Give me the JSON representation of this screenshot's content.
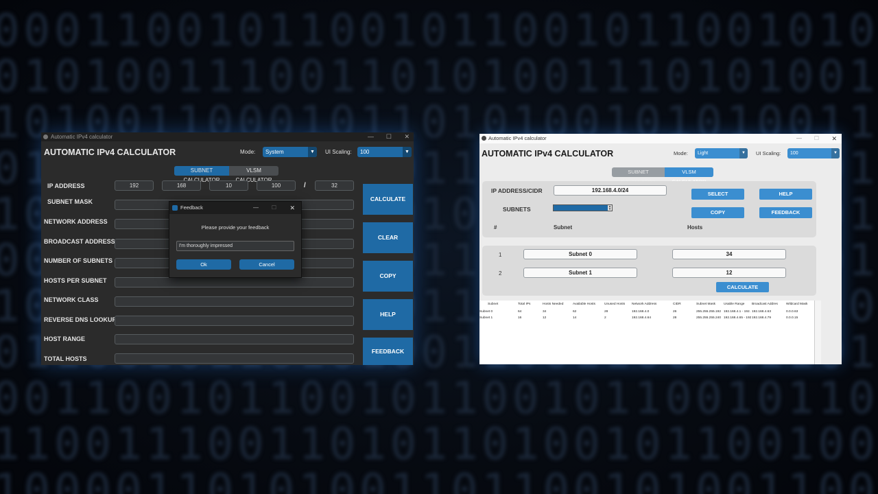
{
  "background": {
    "rows": [
      "000110010110010110010110010100010101110",
      "010100111001101010011101010011011001101",
      "101001100010110101001010100110101101010",
      "011010001011001100101011001010110010110",
      "100110101001101010110011010010110011010",
      "001101001011001101010011001011010010110",
      "101011010011001101010011010100110101100",
      "011001011010100110011001011010011001110",
      "001100101100101100101100101100101100101",
      "110011100110101101001011001001011100111",
      "100001101010011011001010011001010111010"
    ]
  },
  "dark_app": {
    "window_title": "Automatic IPv4 calculator",
    "app_title": "AUTOMATIC IPv4 CALCULATOR",
    "mode_label": "Mode:",
    "mode_value": "System",
    "scaling_label": "UI Scaling:",
    "scaling_value": "100",
    "tabs": [
      "SUBNET CALCULATOR",
      "VLSM CALCULATOR"
    ],
    "active_tab": "SUBNET CALCULATOR",
    "ip_label": "IP  ADDRESS",
    "octets": [
      "192",
      "168",
      "10",
      "100"
    ],
    "slash": "/",
    "cidr": "32",
    "labels": {
      "subnet_mask": "SUBNET  MASK",
      "network_address": "NETWORK ADDRESS",
      "broadcast_address": "BROADCAST ADDRESS",
      "number_of_subnets": "NUMBER OF SUBNETS",
      "hosts_per_subnet": "HOSTS PER SUBNET",
      "network_class": "NETWORK CLASS",
      "reverse_dns": "REVERSE DNS LOOKUP",
      "host_range": "HOST RANGE",
      "total_hosts": "TOTAL HOSTS"
    },
    "buttons": [
      "CALCULATE",
      "CLEAR",
      "COPY",
      "HELP",
      "FEEDBACK"
    ],
    "accent": "#1f6aa5"
  },
  "feedback_dialog": {
    "title": "Feedback",
    "prompt": "Please provide your feedback",
    "input_value": "I'm thoroughly impressed",
    "ok_label": "Ok",
    "cancel_label": "Cancel"
  },
  "light_app": {
    "window_title": "Automatic IPv4 calculator",
    "app_title": "AUTOMATIC IPv4 CALCULATOR",
    "mode_label": "Mode:",
    "mode_value": "Light",
    "scaling_label": "UI Scaling:",
    "scaling_value": "100",
    "tabs": [
      "SUBNET CALCULATOR",
      "VLSM CALCULATOR"
    ],
    "active_tab": "VLSM CALCULATOR",
    "ip_cidr_label": "IP ADDRESS/CIDR",
    "ip_cidr_value": "192.168.4.0/24",
    "subnets_label": "SUBNETS",
    "subnets_value": "2",
    "buttons": {
      "select": "SELECT",
      "help": "HELP",
      "copy": "COPY",
      "feedback": "FEEDBACK",
      "calculate": "CALCULATE"
    },
    "col_headers": {
      "num": "#",
      "subnet": "Subnet",
      "hosts": "Hosts"
    },
    "subnet_rows": [
      {
        "num": "1",
        "name": "Subnet 0",
        "hosts": "34"
      },
      {
        "num": "2",
        "name": "Subnet 1",
        "hosts": "12"
      }
    ],
    "results": {
      "headers": [
        "Subnet",
        "Total IPs",
        "Hosts Needed",
        "Available Hosts",
        "Unused Hosts",
        "Network Address",
        "CIDR",
        "Subnet Mask",
        "Usable Range",
        "Broadcast Addres",
        "Wildcard Mask"
      ],
      "rows": [
        [
          "Subnet 0",
          "64",
          "34",
          "62",
          "28",
          "192.168.4.0",
          "26",
          "255.255.255.192",
          "192.168.4.1 - 192.",
          "192.168.4.63",
          "0.0.0.63"
        ],
        [
          "Subnet 1",
          "16",
          "12",
          "14",
          "2",
          "192.168.4.64",
          "28",
          "255.255.255.240",
          "192.168.4.65 - 192",
          "192.168.4.79",
          "0.0.0.15"
        ]
      ]
    },
    "accent": "#3b8ed0"
  }
}
